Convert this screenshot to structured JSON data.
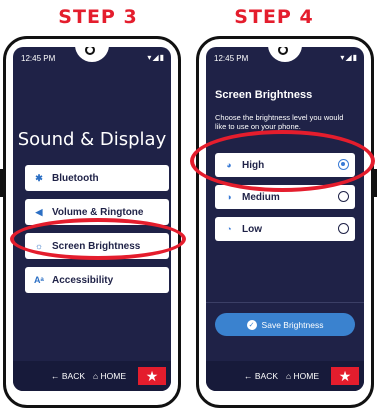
{
  "left": {
    "step_label": "STEP 3",
    "status_time": "12:45 PM",
    "status_icons": "▾◢▮",
    "heading": "Sound & Display",
    "menu": [
      {
        "label": "Bluetooth",
        "icon": "bluetooth-icon",
        "glyph": "✱"
      },
      {
        "label": "Volume & Ringtone",
        "icon": "speaker-icon",
        "glyph": "◀"
      },
      {
        "label": "Screen Brightness",
        "icon": "sun-icon",
        "glyph": "☼"
      },
      {
        "label": "Accessibility",
        "icon": "font-size-icon",
        "glyph": "Aᵃ"
      }
    ],
    "nav": {
      "back": "← BACK",
      "home": "⌂ HOME",
      "star": "★"
    }
  },
  "right": {
    "step_label": "STEP 4",
    "status_time": "12:45 PM",
    "status_icons": "▾◢▮",
    "title": "Screen Brightness",
    "instruction": "Choose the brightness level you would like to use on your phone.",
    "options": [
      {
        "label": "High",
        "icon": "brightness-high-icon",
        "glyph": "◕",
        "selected": true
      },
      {
        "label": "Medium",
        "icon": "brightness-medium-icon",
        "glyph": "◑",
        "selected": false
      },
      {
        "label": "Low",
        "icon": "brightness-low-icon",
        "glyph": "◔",
        "selected": false
      }
    ],
    "save_label": "Save Brightness",
    "save_glyph": "✓",
    "nav": {
      "back": "← BACK",
      "home": "⌂ HOME",
      "star": "★"
    }
  },
  "colors": {
    "accent_red": "#e41d2d",
    "screen_navy": "#1f2247",
    "button_blue": "#3a82cf"
  }
}
